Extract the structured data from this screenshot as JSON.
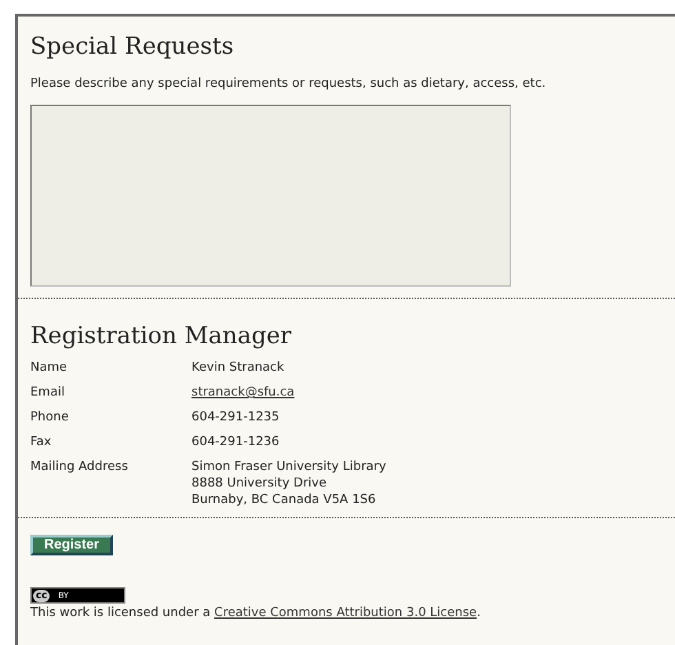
{
  "special_requests": {
    "heading": "Special Requests",
    "description": "Please describe any special requirements or requests, such as dietary, access, etc."
  },
  "registration_manager": {
    "heading": "Registration Manager",
    "fields": [
      {
        "label": "Name",
        "lines": [
          "Kevin Stranack"
        ],
        "kind": "text"
      },
      {
        "label": "Email",
        "lines": [
          "stranack@sfu.ca"
        ],
        "kind": "link"
      },
      {
        "label": "Phone",
        "lines": [
          "604-291-1235"
        ],
        "kind": "text"
      },
      {
        "label": "Fax",
        "lines": [
          "604-291-1236"
        ],
        "kind": "text"
      },
      {
        "label": "Mailing Address",
        "lines": [
          "Simon Fraser University Library",
          "8888 University Drive",
          "Burnaby, BC Canada V5A 1S6"
        ],
        "kind": "text"
      }
    ]
  },
  "register_button": "Register",
  "license": {
    "badge_left": "cc",
    "badge_right": "BY",
    "text_before": "This work is licensed under a ",
    "link": "Creative Commons Attribution 3.0 License",
    "text_after": "."
  }
}
